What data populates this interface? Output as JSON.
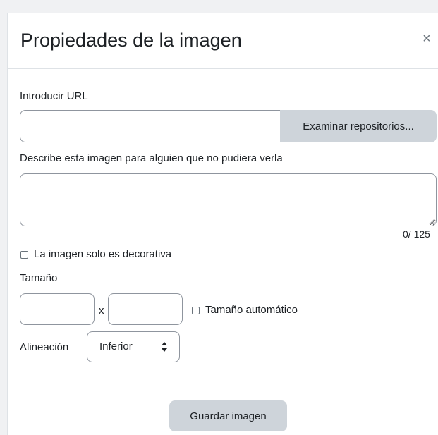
{
  "dialog": {
    "title": "Propiedades de la imagen",
    "close_glyph": "×",
    "close_icon": "close-icon"
  },
  "url": {
    "label": "Introducir URL",
    "value": "",
    "browse_label": "Examinar repositorios..."
  },
  "alt_text": {
    "label": "Describe esta imagen para alguien que no pudiera verla",
    "value": "",
    "counter": "0/ 125"
  },
  "decorative": {
    "label": "La imagen solo es decorativa",
    "checked": false
  },
  "size": {
    "label": "Tamaño",
    "width_value": "",
    "height_value": "",
    "separator": "x",
    "auto_label": "Tamaño automático",
    "auto_checked": false
  },
  "alignment": {
    "label": "Alineación",
    "selected": "Inferior"
  },
  "save_label": "Guardar imagen",
  "colors": {
    "button_bg": "#ced4da",
    "border": "#8f959e",
    "text": "#1d2125"
  }
}
